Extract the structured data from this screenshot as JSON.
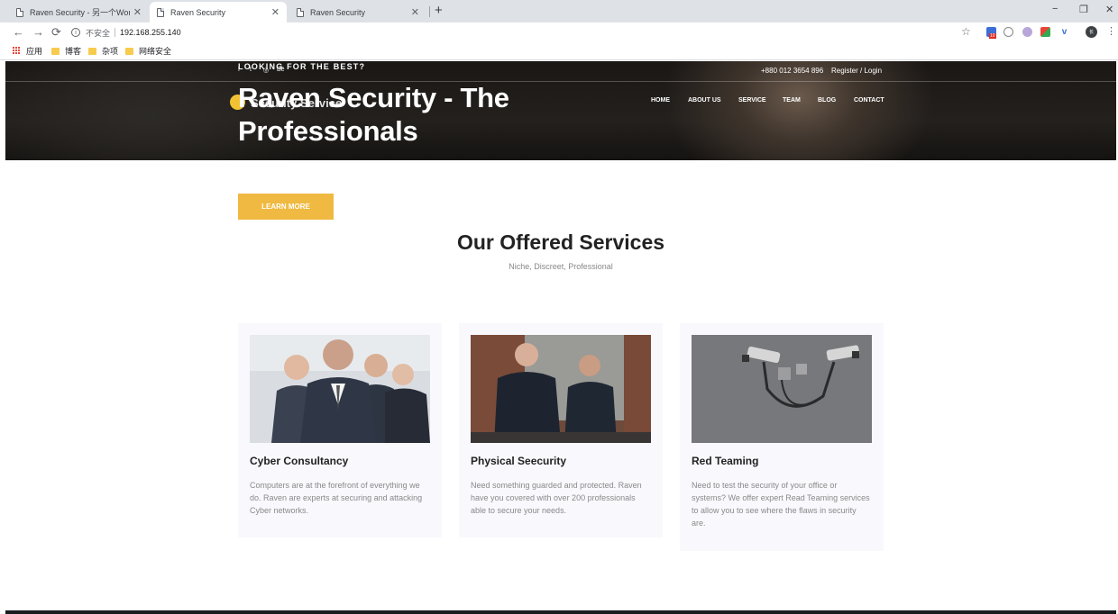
{
  "browser": {
    "tabs": [
      {
        "title": "Raven Security - 另一个WordPres",
        "close": "✕"
      },
      {
        "title": "Raven Security",
        "close": "✕"
      },
      {
        "title": "Raven Security",
        "close": "✕"
      }
    ],
    "new_tab": "+",
    "window_controls": {
      "minimize": "−",
      "restore": "❐",
      "close": "✕"
    },
    "nav": {
      "back": "←",
      "forward": "→",
      "reload": "⟳"
    },
    "address": {
      "security_label": "不安全",
      "url": "192.168.255.140",
      "info_glyph": "i"
    },
    "bookmark_star": "☆",
    "profile_initials": "长",
    "menu": "⋮",
    "extension_badge": "10",
    "bookmarks": [
      {
        "label": "应用",
        "icon": "apps-icon"
      },
      {
        "label": "博客",
        "icon": "folder-icon"
      },
      {
        "label": "杂项",
        "icon": "folder-icon"
      },
      {
        "label": "网络安全",
        "icon": "folder-icon"
      }
    ],
    "colors": {
      "tabbar": "#dee1e6",
      "folder": "#f7cb4d"
    }
  },
  "header": {
    "tagline": "LOOKING FOR THE BEST?",
    "social": [
      "f",
      "t",
      "◎",
      "Bē"
    ],
    "phone": "+880 012 3654 896",
    "auth": "Register / Login",
    "logo_text": "Security Service",
    "title": "Raven Security - The Professionals",
    "nav": [
      "HOME",
      "ABOUT US",
      "SERVICE",
      "TEAM",
      "BLOG",
      "CONTACT"
    ]
  },
  "main": {
    "cta": "LEARN MORE",
    "section_title": "Our Offered Services",
    "section_subtitle": "Niche, Discreet, Professional",
    "accent_color": "#f0b941",
    "services": [
      {
        "title": "Cyber Consultancy",
        "description": "Computers are at the forefront of everything we do. Raven are experts at securing and attacking Cyber networks.",
        "image": "business-team-image"
      },
      {
        "title": "Physical Seecurity",
        "description": "Need something guarded and protected. Raven have you covered with over 200 professionals able to secure your needs.",
        "image": "security-officers-image"
      },
      {
        "title": "Red Teaming",
        "description": "Need to test the security of your office or systems? We offer expert Read Teaming services to allow you to see where the flaws in security are.",
        "image": "cctv-cameras-image"
      }
    ]
  }
}
